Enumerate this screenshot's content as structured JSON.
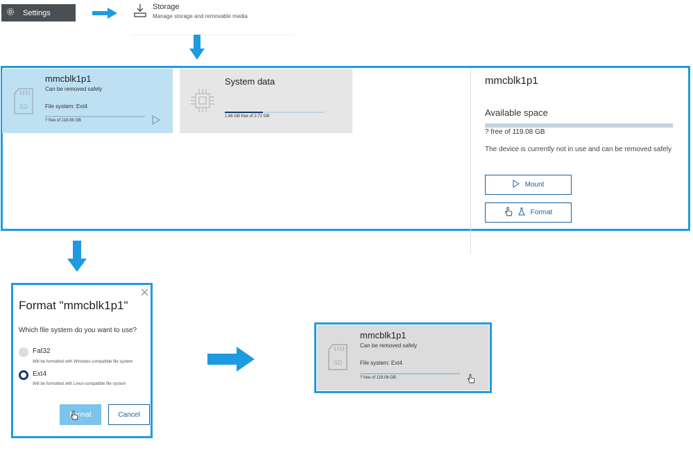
{
  "settings_chip": {
    "label": "Settings",
    "icon": "gear-icon"
  },
  "storage_header": {
    "title": "Storage",
    "description": "Manage storage and removable media",
    "icon": "download-tray-icon"
  },
  "cards": [
    {
      "name": "mmcblk1p1",
      "status": "Can be removed safely",
      "file_system": "File system: Ext4",
      "free": "? free of 119.08 GB",
      "icon": "sd-card-icon",
      "icon_text": "SD",
      "usage_fraction": 0.0
    },
    {
      "name": "System data",
      "free": "1.86 GB free of 2.72 GB",
      "icon": "chip-icon",
      "usage_fraction": 0.38
    }
  ],
  "details": {
    "name": "mmcblk1p1",
    "available_label": "Available space",
    "free": "? free of 119.08 GB",
    "note": "The device is currently not in use and can be removed safely",
    "mount_label": "Mount",
    "format_label": "Format"
  },
  "dialog": {
    "title": "Format \"mmcblk1p1\"",
    "question": "Which file system do you want to use?",
    "options": [
      {
        "label": "Fat32",
        "hint": "Will be formatted with Windows-compatible file system",
        "selected": false
      },
      {
        "label": "Ext4",
        "hint": "Will be formatted with Linux-compatible file system",
        "selected": true
      }
    ],
    "format_label": "Format",
    "cancel_label": "Cancel"
  },
  "result_card": {
    "name": "mmcblk1p1",
    "status": "Can be removed safely",
    "file_system": "File system: Ext4",
    "free": "? free of 119.08 GB",
    "icon_text": "SD"
  },
  "colors": {
    "accent": "#1e9be0",
    "selected_card": "#bde0f2",
    "dark_blue": "#1a5f9a"
  }
}
